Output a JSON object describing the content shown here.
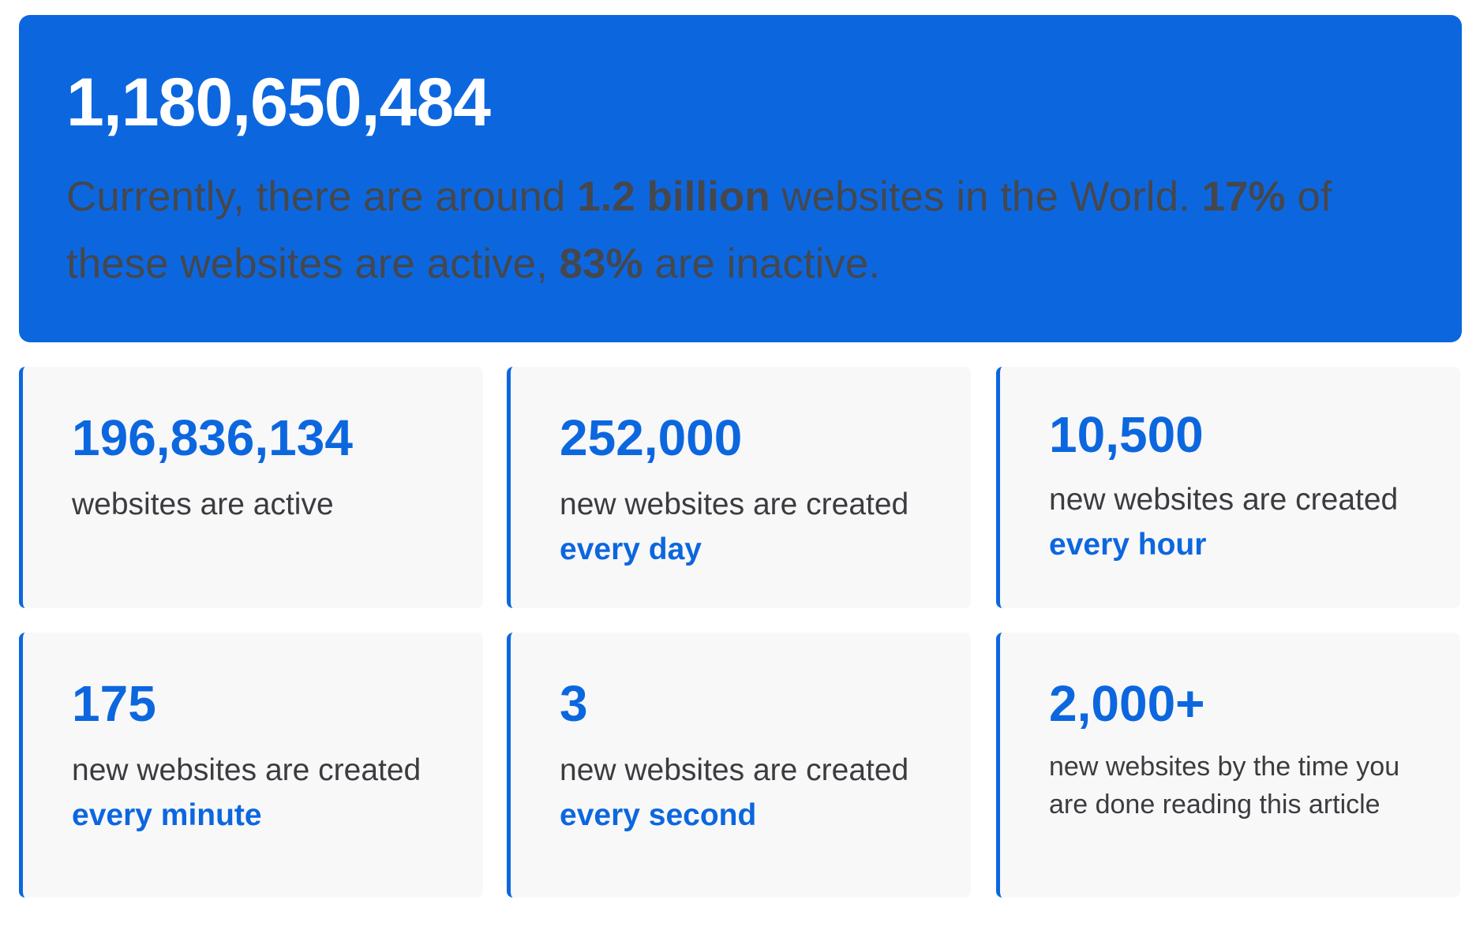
{
  "hero": {
    "total": "1,180,650,484",
    "text_1": "Currently, there are around ",
    "bold_1": "1.2 billion",
    "text_2": " websites in the World. ",
    "bold_2": "17%",
    "text_3": " of these websites are active, ",
    "bold_3": "83%",
    "text_4": " are inactive."
  },
  "cards": [
    {
      "number": "196,836,134",
      "desc": "websites are active",
      "highlight": ""
    },
    {
      "number": "252,000",
      "desc": "new websites are created ",
      "highlight": "every day"
    },
    {
      "number": "10,500",
      "desc": "new websites are created ",
      "highlight": "every hour"
    },
    {
      "number": "175",
      "desc": "new websites are created ",
      "highlight": "every minute"
    },
    {
      "number": "3",
      "desc": "new websites are created ",
      "highlight": "every second"
    },
    {
      "number": "2,000+",
      "desc": "new websites by the time you are done reading this article",
      "highlight": ""
    }
  ],
  "colors": {
    "accent": "#0c67df",
    "card_bg": "#f8f8f8",
    "hero_text": "#45474d",
    "body_text": "#3b3c40"
  }
}
